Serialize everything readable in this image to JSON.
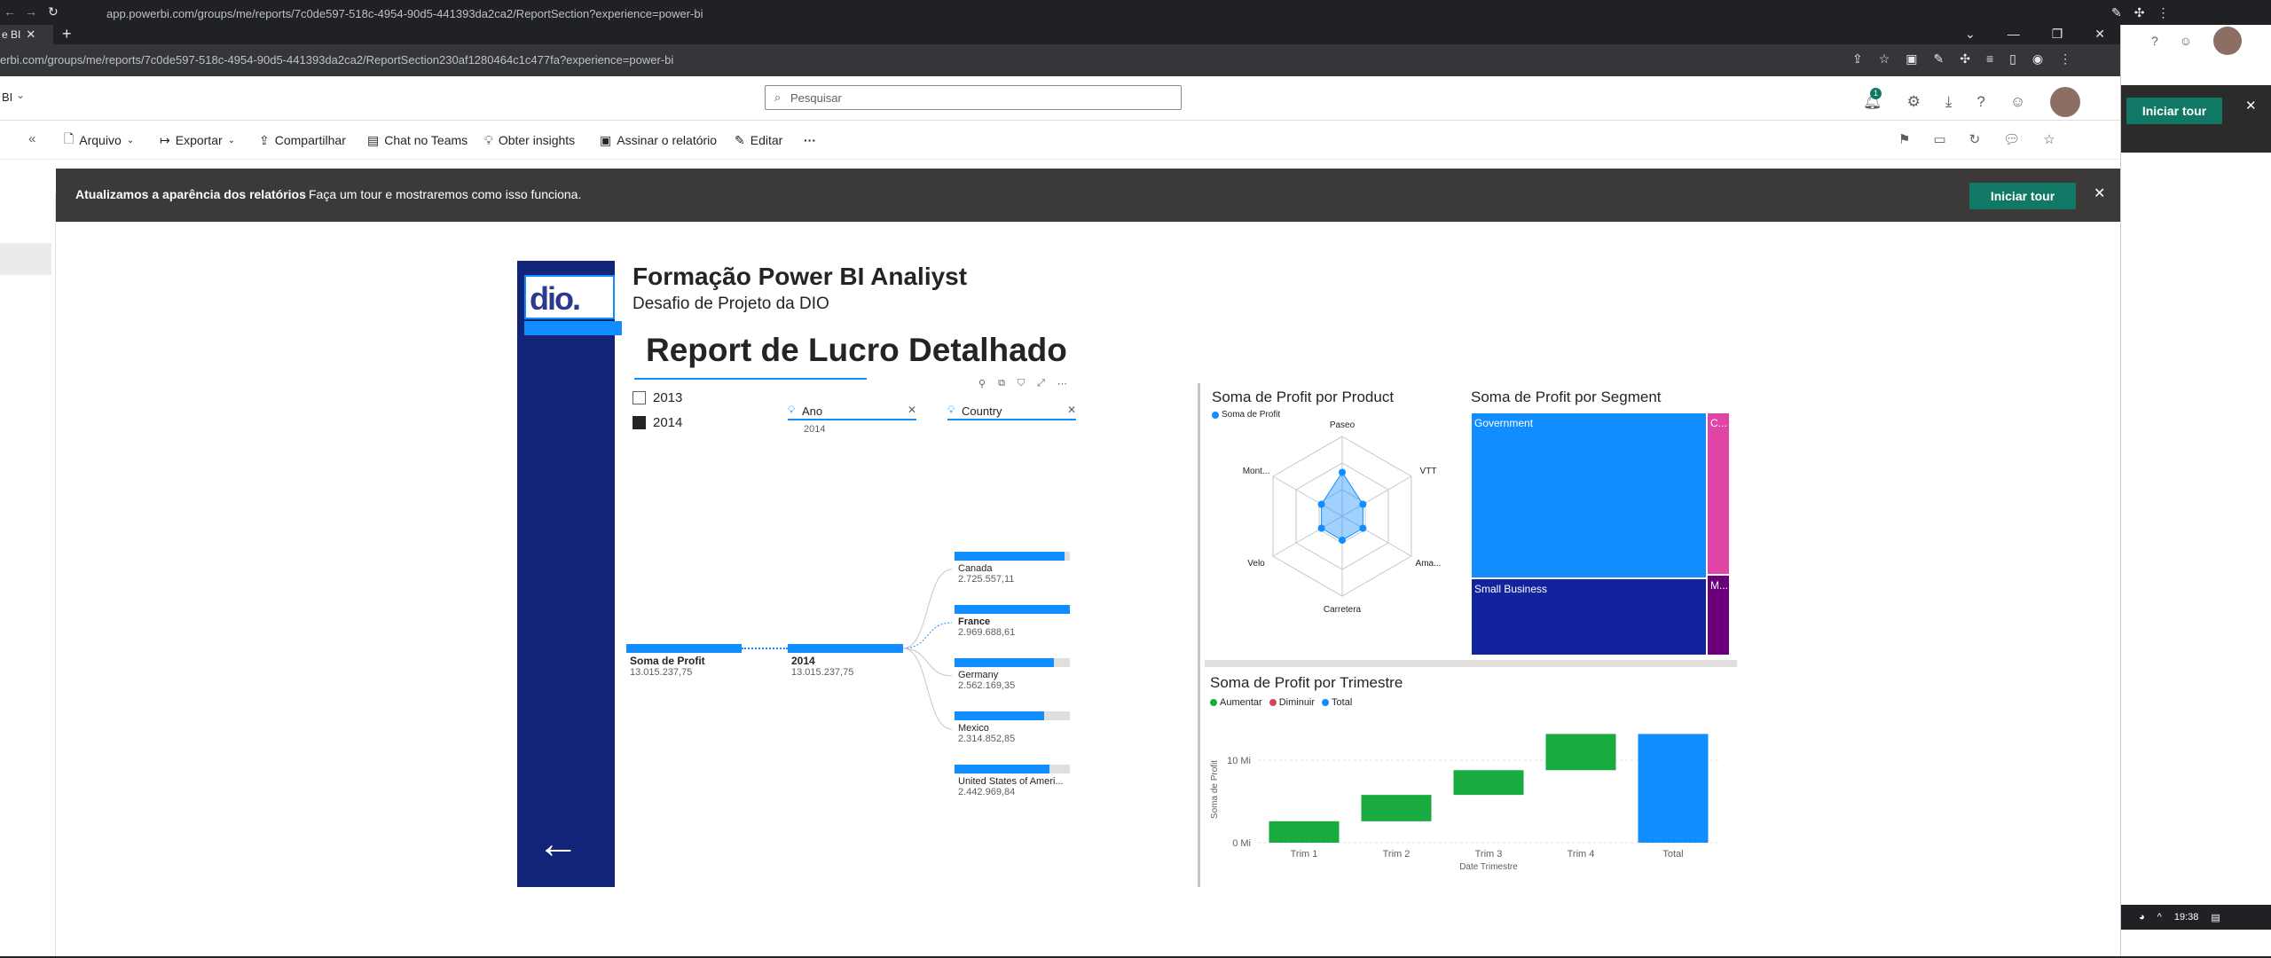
{
  "browser_back": {
    "url": "app.powerbi.com/groups/me/reports/7c0de597-518c-4954-90d5-441393da2ca2/ReportSection?experience=power-bi"
  },
  "browser": {
    "tab_label": "e BI",
    "url": "erbi.com/groups/me/reports/7c0de597-518c-4954-90d5-441393da2ca2/ReportSection230af1280464c1c477fa?experience=power-bi",
    "app_label": "BI"
  },
  "search": {
    "placeholder": "Pesquisar"
  },
  "header": {
    "notification_count": "1"
  },
  "toolbar": {
    "arquivo": "Arquivo",
    "exportar": "Exportar",
    "compartilhar": "Compartilhar",
    "chat": "Chat no Teams",
    "insights": "Obter insights",
    "assinar": "Assinar o relatório",
    "editar": "Editar",
    "more": "···"
  },
  "banner": {
    "bold": "Atualizamos a aparência dos relatórios",
    "text": "Faça um tour e mostraremos como isso funciona.",
    "button": "Iniciar tour"
  },
  "right_window": {
    "button": "Iniciar tour",
    "time": "19:38"
  },
  "report": {
    "logo_text": "dio.",
    "title": "Formação Power BI Analiyst",
    "subtitle": "Desafio de Projeto da DIO",
    "report_title": "Report de Lucro Detalhado",
    "year_slicer": [
      {
        "label": "2013",
        "checked": false
      },
      {
        "label": "2014",
        "checked": true
      }
    ],
    "filter_ano": {
      "label": "Ano",
      "value": "2014"
    },
    "filter_country": {
      "label": "Country"
    },
    "tree": {
      "root": {
        "label": "Soma de Profit",
        "value": "13.015.237,75"
      },
      "year": {
        "label": "2014",
        "value": "13.015.237,75"
      },
      "countries": [
        {
          "name": "Canada",
          "value": "2.725.557,11",
          "bold": false,
          "fill": 0.95
        },
        {
          "name": "France",
          "value": "2.969.688,61",
          "bold": true,
          "fill": 1.0
        },
        {
          "name": "Germany",
          "value": "2.562.169,35",
          "bold": false,
          "fill": 0.86
        },
        {
          "name": "Mexico",
          "value": "2.314.852,85",
          "bold": false,
          "fill": 0.78
        },
        {
          "name": "United States of Ameri...",
          "value": "2.442.969,84",
          "bold": false,
          "fill": 0.82
        }
      ]
    }
  },
  "chart_data": [
    {
      "type": "radar",
      "title": "Soma de Profit por Product",
      "legend": [
        "Soma de Profit"
      ],
      "categories": [
        "Paseo",
        "VTT",
        "Ama...",
        "Carretera",
        "Velo",
        "Mont..."
      ],
      "values": [
        0.55,
        0.3,
        0.3,
        0.3,
        0.3,
        0.3
      ],
      "color": "#118DFF"
    },
    {
      "type": "treemap",
      "title": "Soma de Profit por Segment",
      "items": [
        {
          "label": "Government",
          "color": "#118DFF",
          "value": 0.62
        },
        {
          "label": "Small Business",
          "color": "#12239E",
          "value": 0.29
        },
        {
          "label": "C...",
          "color": "#E044A7",
          "value": 0.06
        },
        {
          "label": "M...",
          "color": "#6B007B",
          "value": 0.03
        }
      ]
    },
    {
      "type": "waterfall",
      "title": "Soma de Profit por Trimestre",
      "legend": [
        {
          "label": "Aumentar",
          "color": "#1AAB40"
        },
        {
          "label": "Diminuir",
          "color": "#D64554"
        },
        {
          "label": "Total",
          "color": "#118DFF"
        }
      ],
      "categories": [
        "Trim 1",
        "Trim 2",
        "Trim 3",
        "Trim 4",
        "Total"
      ],
      "values": [
        2.6,
        3.2,
        3.0,
        4.4,
        13.2
      ],
      "xlabel": "Date Trimestre",
      "ylabel": "Soma de Profit",
      "yticks": [
        "0 Mi",
        "10 Mi"
      ],
      "ylim": [
        0,
        14
      ]
    }
  ]
}
